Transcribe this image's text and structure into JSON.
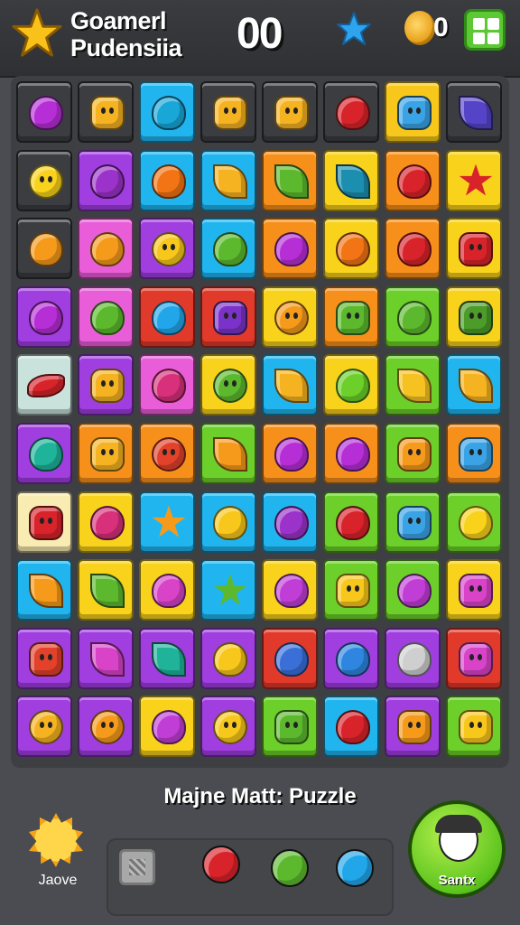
{
  "header": {
    "title_line1": "Goamerl",
    "title_line2": "Pudensiia",
    "score": "00",
    "coin_count": "0",
    "logo_icon": "gold-star-icon",
    "bonus_icon": "blue-star-icon",
    "coin_icon": "coin-icon",
    "menu_icon": "grid-menu-icon"
  },
  "board": {
    "rows": [
      [
        {
          "bg": "#3b3d41",
          "fg": "#b62ed6",
          "shape": "fruit"
        },
        {
          "bg": "#3b3d41",
          "fg": "#f5b221",
          "shape": "gear"
        },
        {
          "bg": "#21b5f0",
          "fg": "#19a7d8",
          "shape": "fruit"
        },
        {
          "bg": "#3b3d41",
          "fg": "#f5b221",
          "shape": "gear"
        },
        {
          "bg": "#3b3d41",
          "fg": "#f5b221",
          "shape": "gear"
        },
        {
          "bg": "#3b3d41",
          "fg": "#d8232a",
          "shape": "fruit"
        },
        {
          "bg": "#f8c71b",
          "fg": "#3aa3e6",
          "shape": "gear"
        },
        {
          "bg": "#3b3d41",
          "fg": "#5644c8",
          "shape": "leaf"
        }
      ],
      [
        {
          "bg": "#3b3d41",
          "fg": "#f8d21b",
          "shape": "face"
        },
        {
          "bg": "#a03ee0",
          "fg": "#9b32c9",
          "shape": "fruit"
        },
        {
          "bg": "#21b5f0",
          "fg": "#f27414",
          "shape": "fruit"
        },
        {
          "bg": "#21b5f0",
          "fg": "#f5b221",
          "shape": "leaf"
        },
        {
          "bg": "#f7901b",
          "fg": "#5cb92d",
          "shape": "leaf"
        },
        {
          "bg": "#f8d21b",
          "fg": "#1c8fb0",
          "shape": "leaf"
        },
        {
          "bg": "#f7901b",
          "fg": "#d8232a",
          "shape": "fruit"
        },
        {
          "bg": "#f8d21b",
          "fg": "#d8232a",
          "shape": "star"
        }
      ],
      [
        {
          "bg": "#3b3d41",
          "fg": "#f59a1b",
          "shape": "fruit"
        },
        {
          "bg": "#e95ed8",
          "fg": "#f59a1b",
          "shape": "fruit"
        },
        {
          "bg": "#a03ee0",
          "fg": "#f8c71b",
          "shape": "face"
        },
        {
          "bg": "#21b5f0",
          "fg": "#5cb92d",
          "shape": "fruit"
        },
        {
          "bg": "#f7901b",
          "fg": "#b62ed6",
          "shape": "fruit"
        },
        {
          "bg": "#f8d21b",
          "fg": "#f27414",
          "shape": "fruit"
        },
        {
          "bg": "#f7901b",
          "fg": "#d8232a",
          "shape": "fruit"
        },
        {
          "bg": "#f8d21b",
          "fg": "#d8232a",
          "shape": "gear"
        }
      ],
      [
        {
          "bg": "#a03ee0",
          "fg": "#b62ed6",
          "shape": "fruit"
        },
        {
          "bg": "#e95ed8",
          "fg": "#5cb92d",
          "shape": "fruit"
        },
        {
          "bg": "#e23a2a",
          "fg": "#21a6ea",
          "shape": "fruit"
        },
        {
          "bg": "#e23a2a",
          "fg": "#7b32c9",
          "shape": "gear"
        },
        {
          "bg": "#f8d21b",
          "fg": "#f59a1b",
          "shape": "face"
        },
        {
          "bg": "#f7901b",
          "fg": "#5cb92d",
          "shape": "gear"
        },
        {
          "bg": "#6ccf2a",
          "fg": "#5cb92d",
          "shape": "fruit"
        },
        {
          "bg": "#f8d21b",
          "fg": "#4c9c2a",
          "shape": "gear"
        }
      ],
      [
        {
          "bg": "#c9e3dc",
          "fg": "#d8232a",
          "shape": "pepper"
        },
        {
          "bg": "#a03ee0",
          "fg": "#f5b221",
          "shape": "gear"
        },
        {
          "bg": "#e95ed8",
          "fg": "#d8307a",
          "shape": "fruit"
        },
        {
          "bg": "#f8d21b",
          "fg": "#5cb92d",
          "shape": "face"
        },
        {
          "bg": "#21b5f0",
          "fg": "#f5b221",
          "shape": "leaf"
        },
        {
          "bg": "#f8d21b",
          "fg": "#6ccf2a",
          "shape": "fruit"
        },
        {
          "bg": "#6ccf2a",
          "fg": "#f5c221",
          "shape": "leaf"
        },
        {
          "bg": "#21b5f0",
          "fg": "#f5b221",
          "shape": "leaf"
        }
      ],
      [
        {
          "bg": "#a03ee0",
          "fg": "#1fb39a",
          "shape": "fruit"
        },
        {
          "bg": "#f7901b",
          "fg": "#f5b221",
          "shape": "gear"
        },
        {
          "bg": "#f7901b",
          "fg": "#e2412a",
          "shape": "face"
        },
        {
          "bg": "#6ccf2a",
          "fg": "#f59a1b",
          "shape": "leaf"
        },
        {
          "bg": "#f7901b",
          "fg": "#b62ed6",
          "shape": "fruit"
        },
        {
          "bg": "#f7901b",
          "fg": "#b62ed6",
          "shape": "fruit"
        },
        {
          "bg": "#6ccf2a",
          "fg": "#f59a1b",
          "shape": "gear"
        },
        {
          "bg": "#f7901b",
          "fg": "#3aa3e6",
          "shape": "gear"
        }
      ],
      [
        {
          "bg": "#f8ecb2",
          "fg": "#d8232a",
          "shape": "gear"
        },
        {
          "bg": "#f8d21b",
          "fg": "#d8307a",
          "shape": "fruit"
        },
        {
          "bg": "#21b5f0",
          "fg": "#f59a1b",
          "shape": "star"
        },
        {
          "bg": "#21b5f0",
          "fg": "#f8c71b",
          "shape": "fruit"
        },
        {
          "bg": "#21b5f0",
          "fg": "#9b32c9",
          "shape": "fruit"
        },
        {
          "bg": "#6ccf2a",
          "fg": "#d8232a",
          "shape": "fruit"
        },
        {
          "bg": "#6ccf2a",
          "fg": "#3aa3e6",
          "shape": "gear"
        },
        {
          "bg": "#6ccf2a",
          "fg": "#f8d21b",
          "shape": "fruit"
        }
      ],
      [
        {
          "bg": "#21b5f0",
          "fg": "#f59a1b",
          "shape": "leaf"
        },
        {
          "bg": "#f8d21b",
          "fg": "#5cb92d",
          "shape": "leaf"
        },
        {
          "bg": "#f8d21b",
          "fg": "#d843c8",
          "shape": "fruit"
        },
        {
          "bg": "#21b5f0",
          "fg": "#5cb92d",
          "shape": "star"
        },
        {
          "bg": "#f8d21b",
          "fg": "#c13ed6",
          "shape": "fruit"
        },
        {
          "bg": "#6ccf2a",
          "fg": "#f8c71b",
          "shape": "gear"
        },
        {
          "bg": "#6ccf2a",
          "fg": "#c13ed6",
          "shape": "fruit"
        },
        {
          "bg": "#f8d21b",
          "fg": "#d843c8",
          "shape": "gear"
        }
      ],
      [
        {
          "bg": "#a03ee0",
          "fg": "#e2412a",
          "shape": "gear"
        },
        {
          "bg": "#a03ee0",
          "fg": "#d843c8",
          "shape": "leaf"
        },
        {
          "bg": "#a03ee0",
          "fg": "#1fb39a",
          "shape": "leaf"
        },
        {
          "bg": "#a03ee0",
          "fg": "#f8c71b",
          "shape": "fruit"
        },
        {
          "bg": "#e23a2a",
          "fg": "#3a6fd8",
          "shape": "fruit"
        },
        {
          "bg": "#a03ee0",
          "fg": "#2e86e0",
          "shape": "fruit"
        },
        {
          "bg": "#a03ee0",
          "fg": "#cfcfcf",
          "shape": "fruit"
        },
        {
          "bg": "#e23a2a",
          "fg": "#d843c8",
          "shape": "gear"
        }
      ],
      [
        {
          "bg": "#a03ee0",
          "fg": "#f5b221",
          "shape": "face"
        },
        {
          "bg": "#a03ee0",
          "fg": "#f59a1b",
          "shape": "face"
        },
        {
          "bg": "#f8d21b",
          "fg": "#c13ed6",
          "shape": "fruit"
        },
        {
          "bg": "#a03ee0",
          "fg": "#f8c71b",
          "shape": "face"
        },
        {
          "bg": "#6ccf2a",
          "fg": "#5cb92d",
          "shape": "gear"
        },
        {
          "bg": "#21b5f0",
          "fg": "#d8232a",
          "shape": "fruit"
        },
        {
          "bg": "#a03ee0",
          "fg": "#f59a1b",
          "shape": "gear"
        },
        {
          "bg": "#6ccf2a",
          "fg": "#f8c71b",
          "shape": "gear"
        }
      ]
    ]
  },
  "footer": {
    "title": "Majne Matt: Puzzle",
    "left_label": "Jaove",
    "left_icon": "sun-icon",
    "slot_icon": "locked-slot-icon",
    "tray_items": [
      {
        "name": "red-apple-icon",
        "color": "#d8232a"
      },
      {
        "name": "green-apple-icon",
        "color": "#5cb92d"
      },
      {
        "name": "blue-berry-icon",
        "color": "#21a6ea"
      }
    ],
    "play_label": "Santx",
    "play_icon": "character-face-icon"
  }
}
